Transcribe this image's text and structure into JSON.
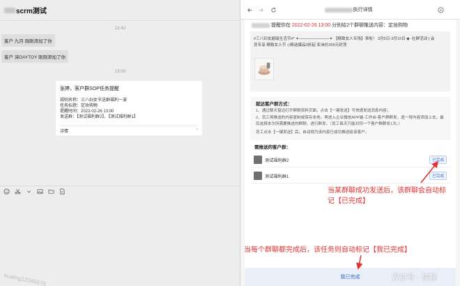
{
  "chat": {
    "title": "scrm测试",
    "time1": "12:42",
    "sys_msg1": "客户 九月 刚刚添加了你",
    "sys_msg2": "客户 诗DAYTOY 刚刚添加了你",
    "time2": "13:00",
    "card": {
      "title": "张婷，客户群SOP任务提醒",
      "rule": "规则名称：三八妇女节送群福利一波",
      "task_title": "任务标题：定妆购物",
      "remind_time": "提醒时间：2022-02-26 13:00",
      "send_groups": "发送群：【测试福利群2】、【测试福利群1】",
      "detail": "详情",
      "arrow": "›"
    },
    "toolbar_icons": [
      "emoji-icon",
      "scissors-icon",
      "dropdown-icon",
      "image-icon",
      "folder-icon",
      "doc-icon"
    ],
    "watermark": "kualing12345678"
  },
  "browser": {
    "title": "执行详情",
    "head": {
      "prefix": "提醒你在",
      "time": "2022-02-26 13:00",
      "suffix": "分别给2个群聊推送内容：定妆购物"
    },
    "message_lines": [
      "#三八妇女超级生活节#*  ✦───────────✦ 【精致女人专场】来啦！ 3月5日-3月10日 ◆ ·社群活动 | 会",
      "员专享 精致女人节 ◇精选爆品3折起 亚洲价269元封顶"
    ],
    "howto": {
      "title": "就达客户群方式：",
      "lines": [
        "1、通过聊天窗边打开群聊资料页面，点击【一键发送】可快速发送消息内容；",
        "2、员工将推送的内容复制或保存本地，再进入企业微信APP端-工作台-客户群群发，逐一将内容添加上去，最",
        "后选择本次所需要推送的群聊，进行群发。（员工每天只能对同一个客户群群发1次。）",
        "员工点击【一键发送】后，自动视为该内容已成功推送给该客户。"
      ]
    },
    "groups_title": "需推送的客户群：",
    "groups": [
      {
        "name": "测试福利群2",
        "status": "已完成"
      },
      {
        "name": "测试福利群1",
        "status": "已完成"
      }
    ],
    "done_label": "我已完成"
  },
  "annotations": {
    "note1_line1": "当某群聊成功发送后，该群聊会自动标",
    "note1_line2": "记【已完成】",
    "note2": "当每个群聊都完成后，该任务则自动标记【我已完成】",
    "color": "#e23232"
  },
  "brand": "汉京号 · 快鲸"
}
